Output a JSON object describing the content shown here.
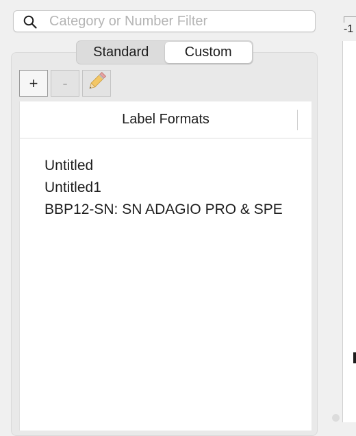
{
  "search": {
    "placeholder": "Category or Number Filter",
    "icon": "search-icon"
  },
  "tabs": [
    {
      "label": "Standard",
      "active": false
    },
    {
      "label": "Custom",
      "active": true
    }
  ],
  "toolbar": {
    "add_label": "+",
    "remove_label": "-",
    "edit_icon": "pencil-icon"
  },
  "list": {
    "header": "Label Formats",
    "items": [
      {
        "label": "Untitled"
      },
      {
        "label": "Untitled1"
      },
      {
        "label": "BBP12-SN: SN ADAGIO PRO & SPE"
      }
    ]
  },
  "ruler": {
    "label": "-1"
  },
  "colors": {
    "panel_bg": "#e9e9e9",
    "window_bg": "#f0f0f0",
    "active_tab_bg": "#ffffff",
    "placeholder_text": "#b4b4b4",
    "pencil_body": "#f3c766",
    "pencil_tip": "#e8a0a0"
  }
}
